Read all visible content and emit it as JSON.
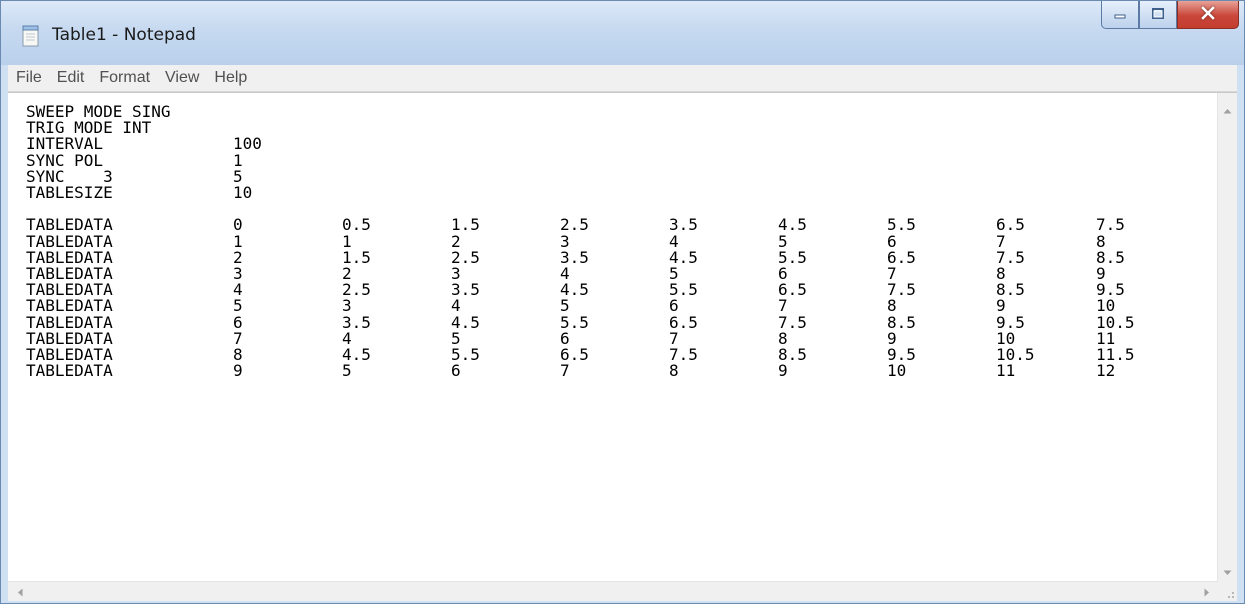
{
  "window": {
    "title": "Table1 - Notepad"
  },
  "menu": [
    "File",
    "Edit",
    "Format",
    "View",
    "Help"
  ],
  "header_lines": [
    [
      "SWEEP MODE SING",
      ""
    ],
    [
      "TRIG MODE INT",
      ""
    ],
    [
      "INTERVAL",
      "100"
    ],
    [
      "SYNC POL",
      "1"
    ],
    [
      "SYNC    3",
      "5"
    ],
    [
      "TABLESIZE",
      "10"
    ]
  ],
  "table_rows": [
    [
      "TABLEDATA",
      "0",
      "0.5",
      "1.5",
      "2.5",
      "3.5",
      "4.5",
      "5.5",
      "6.5",
      "7.5"
    ],
    [
      "TABLEDATA",
      "1",
      "1",
      "2",
      "3",
      "4",
      "5",
      "6",
      "7",
      "8"
    ],
    [
      "TABLEDATA",
      "2",
      "1.5",
      "2.5",
      "3.5",
      "4.5",
      "5.5",
      "6.5",
      "7.5",
      "8.5"
    ],
    [
      "TABLEDATA",
      "3",
      "2",
      "3",
      "4",
      "5",
      "6",
      "7",
      "8",
      "9"
    ],
    [
      "TABLEDATA",
      "4",
      "2.5",
      "3.5",
      "4.5",
      "5.5",
      "6.5",
      "7.5",
      "8.5",
      "9.5"
    ],
    [
      "TABLEDATA",
      "5",
      "3",
      "4",
      "5",
      "6",
      "7",
      "8",
      "9",
      "10"
    ],
    [
      "TABLEDATA",
      "6",
      "3.5",
      "4.5",
      "5.5",
      "6.5",
      "7.5",
      "8.5",
      "9.5",
      "10.5"
    ],
    [
      "TABLEDATA",
      "7",
      "4",
      "5",
      "6",
      "7",
      "8",
      "9",
      "10",
      "11"
    ],
    [
      "TABLEDATA",
      "8",
      "4.5",
      "5.5",
      "6.5",
      "7.5",
      "8.5",
      "9.5",
      "10.5",
      "11.5"
    ],
    [
      "TABLEDATA",
      "9",
      "5",
      "6",
      "7",
      "8",
      "9",
      "10",
      "11",
      "12"
    ]
  ],
  "icons": {
    "app": "notepad-icon",
    "minimize": "minimize-icon",
    "maximize": "maximize-icon",
    "close": "close-icon"
  },
  "colors": {
    "close_button": "#c43d2f",
    "titlebar": "#c6d9f0"
  }
}
